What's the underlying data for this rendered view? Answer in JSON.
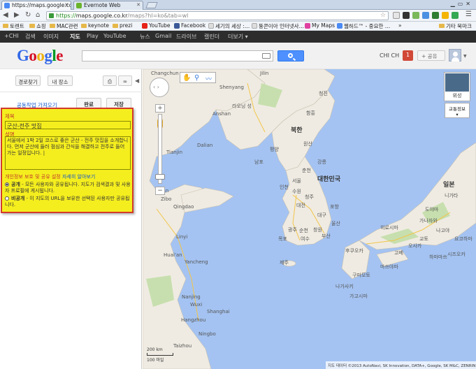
{
  "tabs": [
    {
      "title": "https://maps.google.co",
      "active": true
    },
    {
      "title": "Evernote Web",
      "active": false
    }
  ],
  "toolbar": {
    "url_scheme": "https://",
    "url_host": "maps.google.co.kr",
    "url_path": "/maps?hl=ko&tab=wl"
  },
  "bookmarks": [
    {
      "label": "토렌트",
      "icon": "folder-icon"
    },
    {
      "label": "쇼핑",
      "icon": "folder-icon"
    },
    {
      "label": "MAC관련",
      "icon": "folder-icon"
    },
    {
      "label": "keynote",
      "icon": "folder-icon"
    },
    {
      "label": "prezi",
      "icon": "folder-icon"
    },
    {
      "label": "YouTube",
      "icon": "youtube-icon"
    },
    {
      "label": "Facebook",
      "icon": "facebook-icon"
    },
    {
      "label": "세기의 세상 :…",
      "icon": "page-icon"
    },
    {
      "label": "뚱콘이아 인터넷사…",
      "icon": "page-icon"
    },
    {
      "label": "My Maps",
      "icon": "maps-icon"
    },
    {
      "label": "웹하드™ - 중요한 …",
      "icon": "page-icon"
    }
  ],
  "bookmarks_overflow": "»",
  "bookmarks_other": "기타 북마크",
  "gbar": {
    "items": [
      "+CHI",
      "검색",
      "이미지",
      "지도",
      "Play",
      "YouTube",
      "뉴스",
      "Gmail",
      "드라이브",
      "캘린더",
      "더보기 ▾"
    ],
    "selected": "지도"
  },
  "header": {
    "logo": "Google",
    "user": "CHI CH",
    "notifications": "1",
    "share": "+ 공유"
  },
  "left": {
    "btn_directions": "경로찾기",
    "btn_myplaces": "내 장소",
    "collaborate": "공동작업",
    "import": "가져오기",
    "done": "완료",
    "save": "저장",
    "title_label": "제목",
    "title_value": "군산-전주 맛집",
    "desc_label": "설명",
    "desc_value": "서울에서 1박 2일 코스로 좋은 군산 - 전주 맛집을 소개합니다. 먼저 군산에 들러 점심과 간식을 해결하고 전주로 들어가는 일정입니다. |",
    "privacy_label": "개인정보 보호 및 공유 설정",
    "learn_more": "자세히 알아보기",
    "public_title": "공개",
    "public_desc": " - 모든 사용자와 공유됩니다. 지도가 검색결과 및 사용자 프로필에 게시됩니다.",
    "private_title": "비공개",
    "private_desc": " - 이 지도의 URL을 보유한 선택된 사용자만 공유됩니다."
  },
  "map": {
    "countries": [
      "북한",
      "대한민국",
      "일본"
    ],
    "cities": [
      "Changchun",
      "Jilin",
      "Shenyang",
      "라오닝 성",
      "Anshan",
      "Dalian",
      "Tianjin",
      "Jinan",
      "Qingdao",
      "Zibo",
      "Linyi",
      "Yancheng",
      "Huai'an",
      "Nanjing",
      "Wuxi",
      "Shanghai",
      "Hangzhou",
      "Ningbo",
      "Taizhou",
      "평양",
      "남포",
      "원산",
      "함흥",
      "청진",
      "서울",
      "인천",
      "수원",
      "춘천",
      "강릉",
      "대전",
      "청주",
      "대구",
      "포항",
      "울산",
      "부산",
      "광주",
      "제주",
      "여수",
      "창원",
      "순천",
      "목포",
      "나가사키",
      "후쿠오카",
      "구마모토",
      "가고시마",
      "마쓰야마",
      "히로시마",
      "오사카",
      "고베",
      "교토",
      "나고야",
      "도야마",
      "가나자와",
      "니가타",
      "시즈오카",
      "하마마쓰",
      "요코하마"
    ],
    "satellite": "위성",
    "traffic": "교통정보",
    "scale_top": "200 km",
    "scale_bottom": "100 마일",
    "attribution": "지도 데이터 ©2013 AutoNavi, SK Innovation, DATA+, Google, SK M&C, ZENRIN",
    "colors": {
      "water": "#a4c3f2",
      "land": "#efebe2",
      "park": "#c7dfae"
    }
  }
}
